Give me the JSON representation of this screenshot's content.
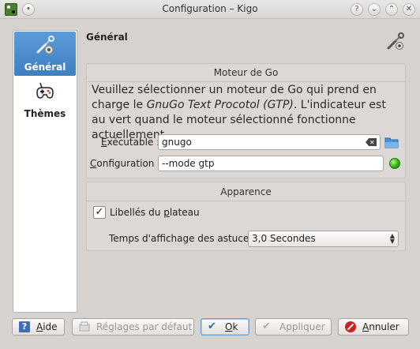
{
  "window": {
    "title": "Configuration – Kigo",
    "controls": {
      "help": "?",
      "minimize": "⌄",
      "maximize": "⌃",
      "close": "✕"
    }
  },
  "sidebar": {
    "items": [
      {
        "label": "Général",
        "icon": "tools-icon",
        "active": true
      },
      {
        "label": "Thèmes",
        "icon": "gamepad-icon",
        "active": false
      }
    ]
  },
  "page": {
    "title": "Général"
  },
  "engine_group": {
    "title": "Moteur de Go",
    "description_1": "Veuillez sélectionner un moteur de Go qui prend en charge le ",
    "description_italic": "GnuGo Text Procotol (GTP)",
    "description_2": ". L'indicateur est au vert quand le moteur sélectionné fonctionne actuellement.",
    "executable_label_u": "E",
    "executable_label_rest": "xécutable :",
    "executable_value": "gnugo",
    "configuration_label_u": "C",
    "configuration_label_rest": "onfiguration :",
    "configuration_value": "--mode gtp",
    "status_color": "#2aa80e"
  },
  "appearance_group": {
    "title": "Apparence",
    "board_labels_checkbox_a": "Libellés du ",
    "board_labels_checkbox_u": "p",
    "board_labels_checkbox_b": "lateau",
    "board_labels_checked": true,
    "hint_time_label": "Temps d'affichage des astuces :",
    "hint_time_value": "3,0 Secondes"
  },
  "buttons": {
    "help": {
      "u": "A",
      "rest": "ide"
    },
    "defaults": "Réglages par défaut",
    "ok": {
      "u": "O",
      "rest": "k"
    },
    "apply": "Appliquer",
    "cancel": {
      "u": "A",
      "rest": "nnuler"
    }
  }
}
